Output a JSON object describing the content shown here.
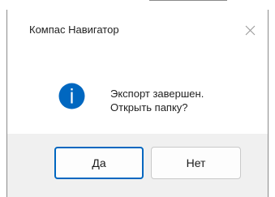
{
  "window": {
    "title": "Компас Навигатор",
    "close_icon": "close-icon"
  },
  "message": {
    "icon": "info-icon",
    "icon_color": "#0067c0",
    "line1": "Экспорт завершен.",
    "line2": "Открыть папку?"
  },
  "buttons": {
    "yes_label": "Да",
    "no_label": "Нет",
    "default_border_color": "#0067c0"
  }
}
